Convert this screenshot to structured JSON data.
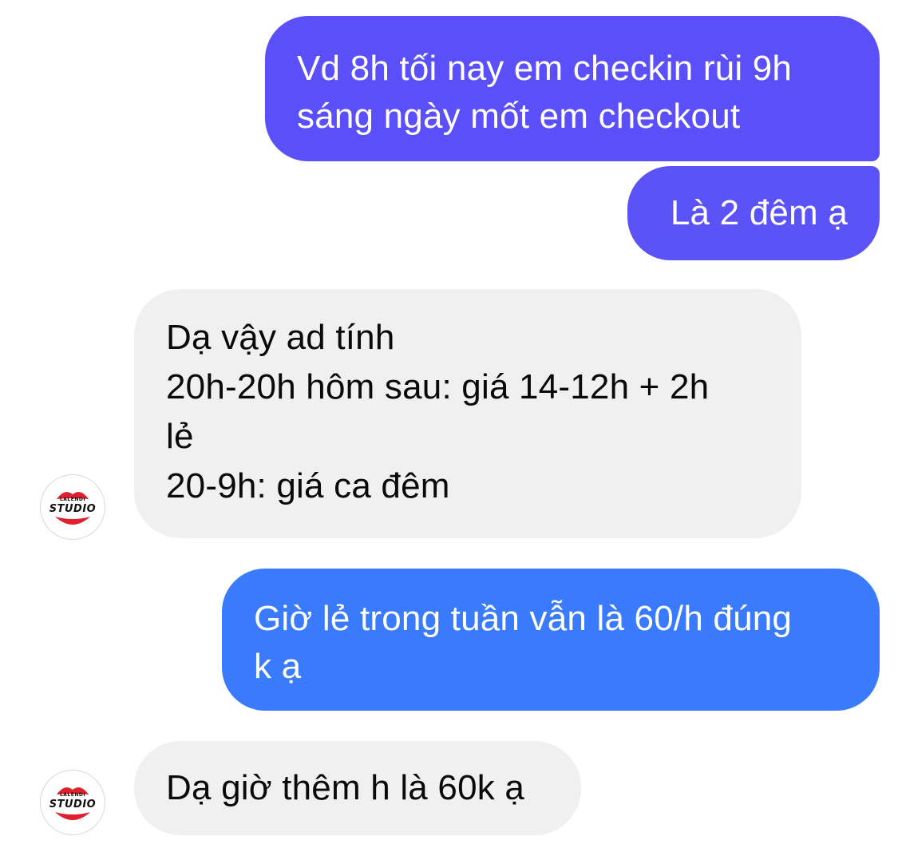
{
  "messages": [
    {
      "direction": "outgoing",
      "text": "Vd 8h tối nay em checkin rùi 9h\nsáng ngày mốt em checkout",
      "color": "#5a4ff8"
    },
    {
      "direction": "outgoing",
      "text": "Là 2 đêm ạ",
      "color": "#5b52f7"
    },
    {
      "direction": "incoming",
      "text": "Dạ vậy ad tính\n20h-20h hôm sau: giá 14-12h + 2h\nlẻ\n20-9h: giá ca đêm",
      "color": "#f0f0f0"
    },
    {
      "direction": "outgoing",
      "text": "Giờ lẻ trong tuần vẫn là 60/h đúng\nk ạ",
      "color": "#3a7afc"
    },
    {
      "direction": "incoming",
      "text": "Dạ giờ thêm h là 60k ạ",
      "color": "#f0f0f0"
    }
  ],
  "avatar": {
    "icon": "lips-logo-icon",
    "small_text": "LALENDI",
    "main_text": "STUDIO",
    "accent": "#e0202e"
  }
}
